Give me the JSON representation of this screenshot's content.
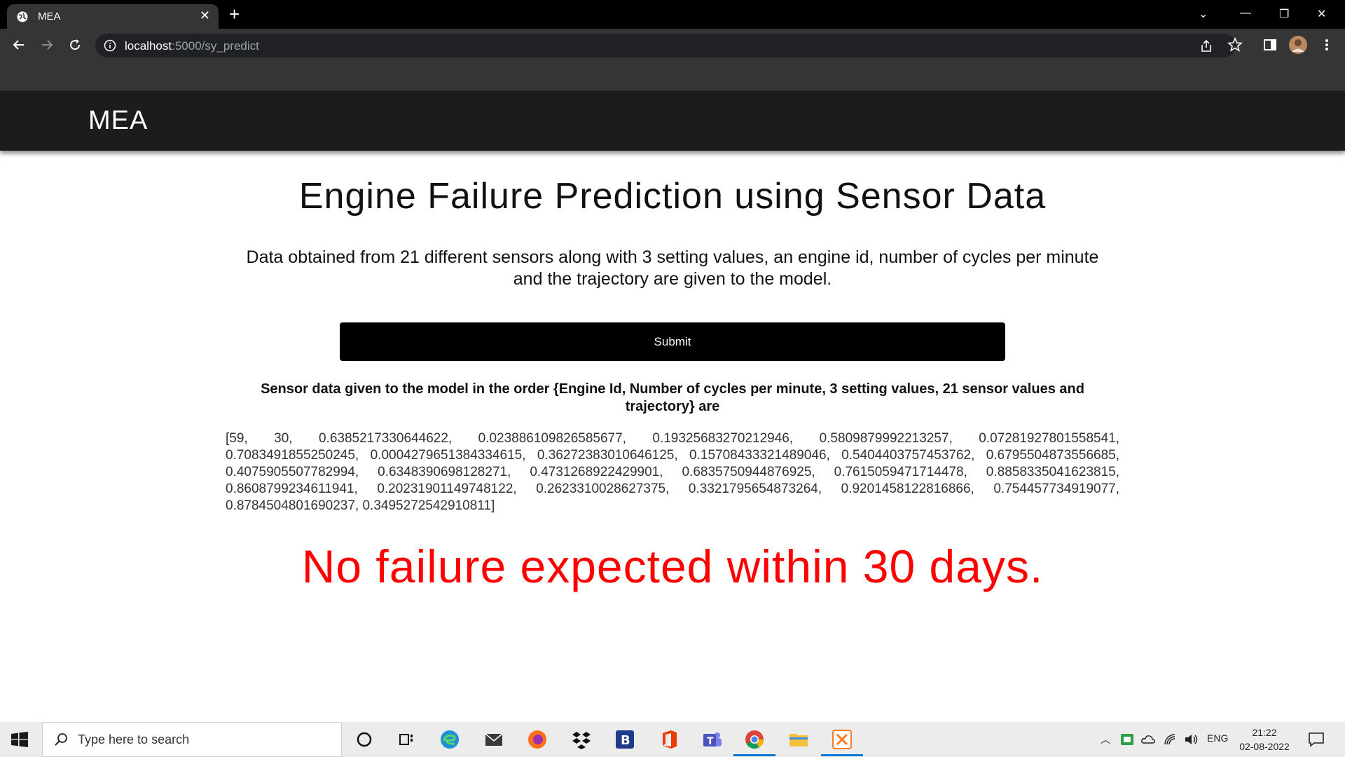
{
  "browser": {
    "tab_title": "MEA",
    "url_host": "localhost",
    "url_path": ":5000/sy_predict"
  },
  "navbar": {
    "brand": "MEA"
  },
  "main": {
    "title": "Engine Failure Prediction using Sensor Data",
    "description": "Data obtained from 21 different sensors along with 3 setting values, an engine id, number of cycles per minute and the trajectory are given to the model.",
    "submit_label": "Submit",
    "sensor_heading": "Sensor data given to the model in the order {Engine Id, Number of cycles per minute, 3 setting values, 21 sensor values and trajectory} are",
    "sensor_values": "[59, 30, 0.6385217330644622, 0.023886109826585677, 0.19325683270212946, 0.5809879992213257, 0.07281927801558541, 0.7083491855250245, 0.0004279651384334615, 0.36272383010646125, 0.15708433321489046, 0.5404403757453762, 0.6795504873556685, 0.4075905507782994, 0.6348390698128271, 0.4731268922429901, 0.6835750944876925, 0.7615059471714478, 0.8858335041623815, 0.8608799234611941, 0.20231901149748122, 0.2623310028627375, 0.3321795654873264, 0.9201458122816866, 0.754457734919077, 0.8784504801690237, 0.3495272542910811]",
    "result": "No failure expected within 30 days.",
    "result_color": "#ff0000"
  },
  "taskbar": {
    "search_placeholder": "Type here to search",
    "language": "ENG",
    "time": "21:22",
    "date": "02-08-2022",
    "apps": [
      "cortana-icon",
      "task-view-icon",
      "edge-icon",
      "mail-icon",
      "firefox-icon",
      "dropbox-icon",
      "b-app-icon",
      "office-icon",
      "teams-icon",
      "chrome-icon",
      "file-explorer-icon",
      "xampp-icon"
    ]
  }
}
